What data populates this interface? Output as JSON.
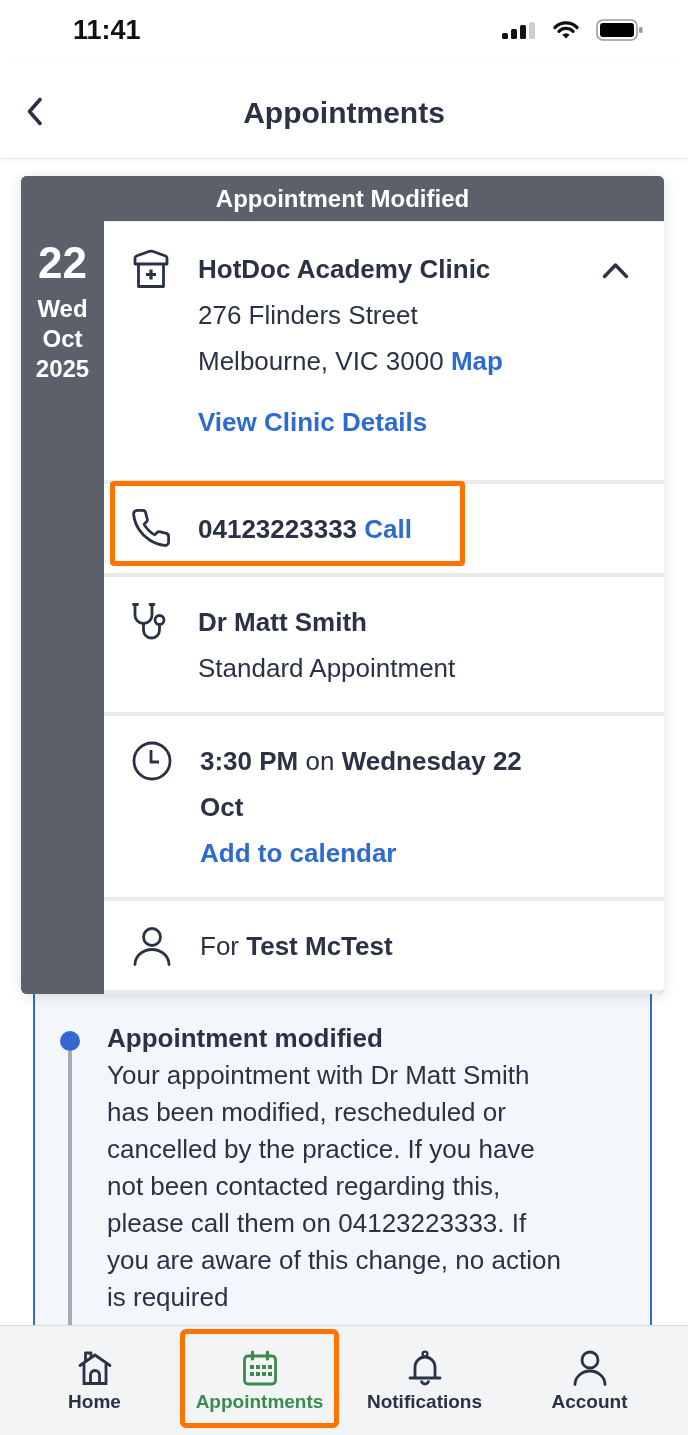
{
  "status_bar": {
    "time": "11:41"
  },
  "header": {
    "title": "Appointments"
  },
  "appointment": {
    "banner": "Appointment Modified",
    "expanded": true,
    "date": {
      "day": "22",
      "weekday": "Wed",
      "month": "Oct",
      "year": "2025"
    },
    "sections": [
      {
        "kind": "clinic",
        "highlighted": false,
        "name": "HotDoc Academy Clinic",
        "address_line_1": "276 Flinders Street",
        "address_line_2": "Melbourne, VIC 3000",
        "map_link": "Map",
        "details_link": "View Clinic Details"
      },
      {
        "kind": "phone",
        "highlighted": true,
        "number": "04123223333",
        "call_link": "Call"
      },
      {
        "kind": "practitioner",
        "highlighted": false,
        "name": "Dr Matt Smith",
        "appointment_type": "Standard Appointment"
      },
      {
        "kind": "time",
        "highlighted": false,
        "text": "**3:30 PM** on **Wednesday 22 Oct**",
        "calendar_link": "Add to calendar"
      },
      {
        "kind": "patient",
        "highlighted": false,
        "text": "For **Test McTest**"
      }
    ]
  },
  "history": {
    "events": [
      {
        "title": "Appointment modified",
        "text": "Your appointment with Dr Matt Smith has been modified, rescheduled or cancelled by the practice. If you have not been contacted regarding this, please call them on 04123223333. If you are aware of this change, no action is required"
      }
    ]
  },
  "tab_bar": {
    "tabs": [
      {
        "kind": "home",
        "label": "Home",
        "selected": false,
        "highlighted": false
      },
      {
        "kind": "appointments",
        "label": "Appointments",
        "selected": true,
        "highlighted": true
      },
      {
        "kind": "notifications",
        "label": "Notifications",
        "selected": false,
        "highlighted": false
      },
      {
        "kind": "account",
        "label": "Account",
        "selected": false,
        "highlighted": false
      }
    ]
  }
}
